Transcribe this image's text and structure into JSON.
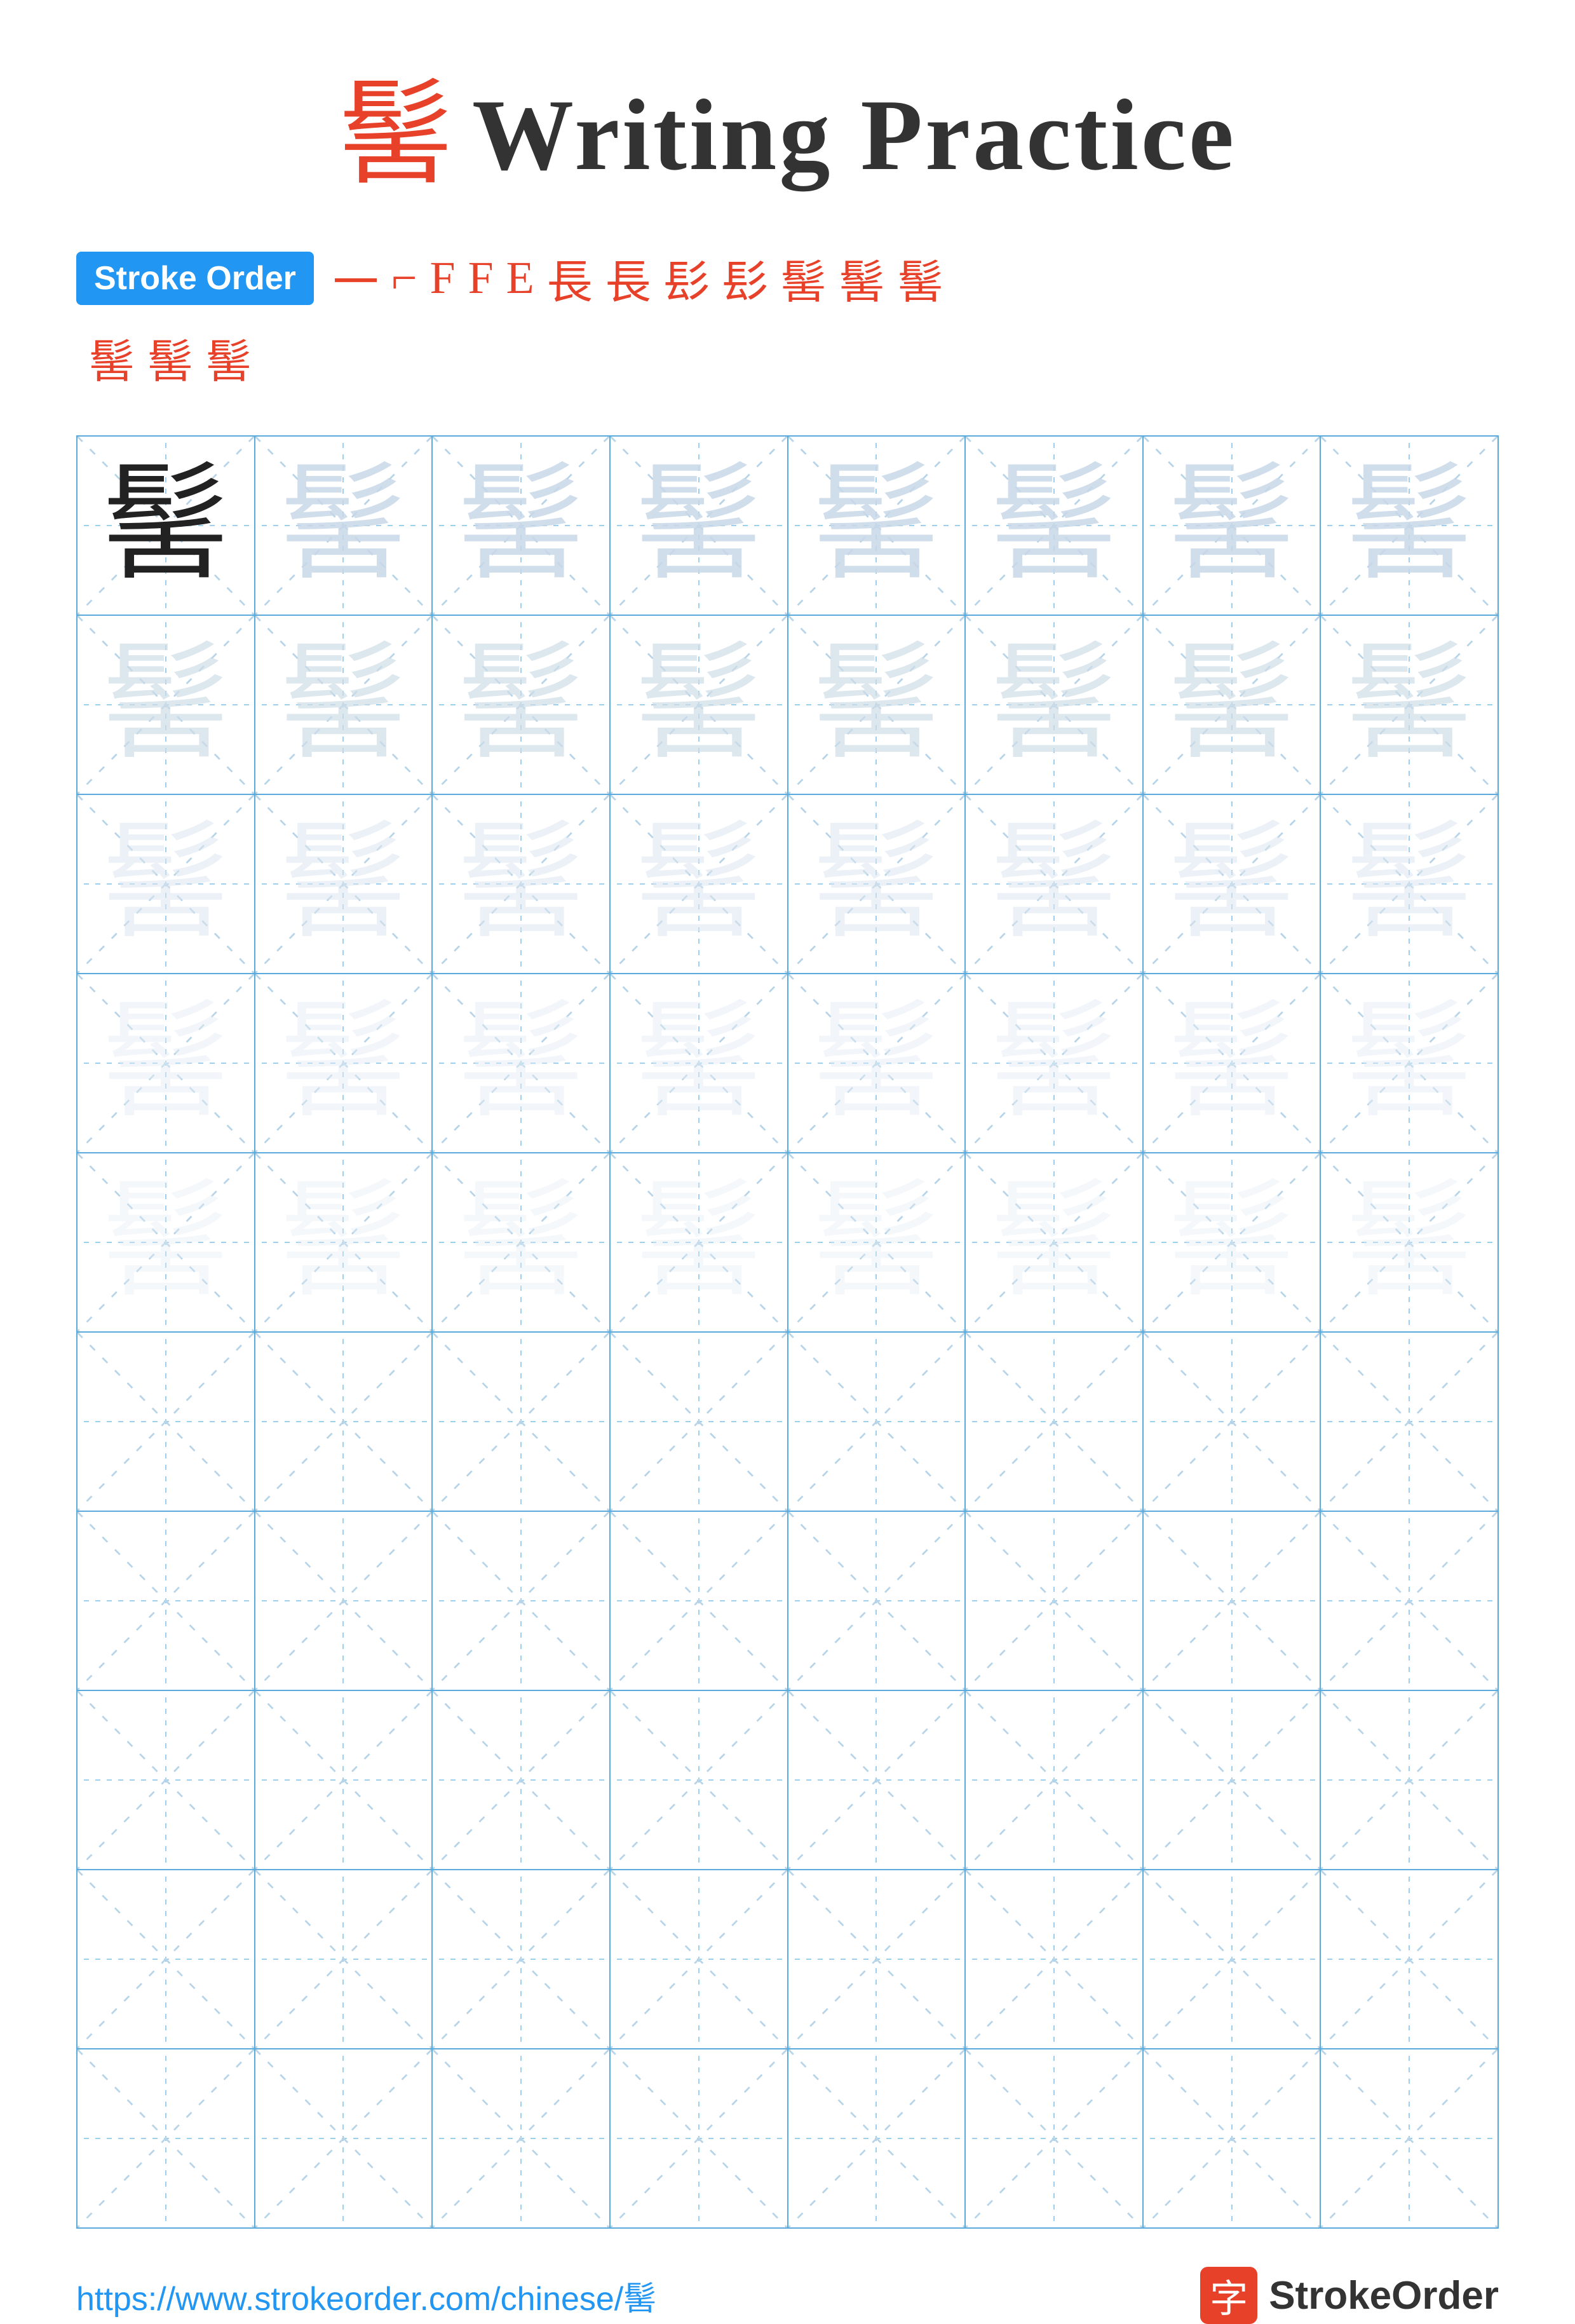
{
  "title": {
    "char": "髺",
    "text": "Writing Practice"
  },
  "stroke_order": {
    "badge_label": "Stroke Order",
    "strokes_row1": [
      "一",
      "ㄇ",
      "F",
      "E",
      "E",
      "長",
      "長",
      "髟",
      "髟",
      "髺",
      "髺",
      "髺"
    ],
    "strokes_row2": [
      "髺",
      "髺",
      "髺"
    ]
  },
  "practice_char": "髺",
  "grid": {
    "cols": 8,
    "rows": 10,
    "filled_rows": 5,
    "empty_rows": 5
  },
  "footer": {
    "url": "https://www.strokeorder.com/chinese/髺",
    "logo_char": "字",
    "logo_text": "StrokeOrder"
  }
}
